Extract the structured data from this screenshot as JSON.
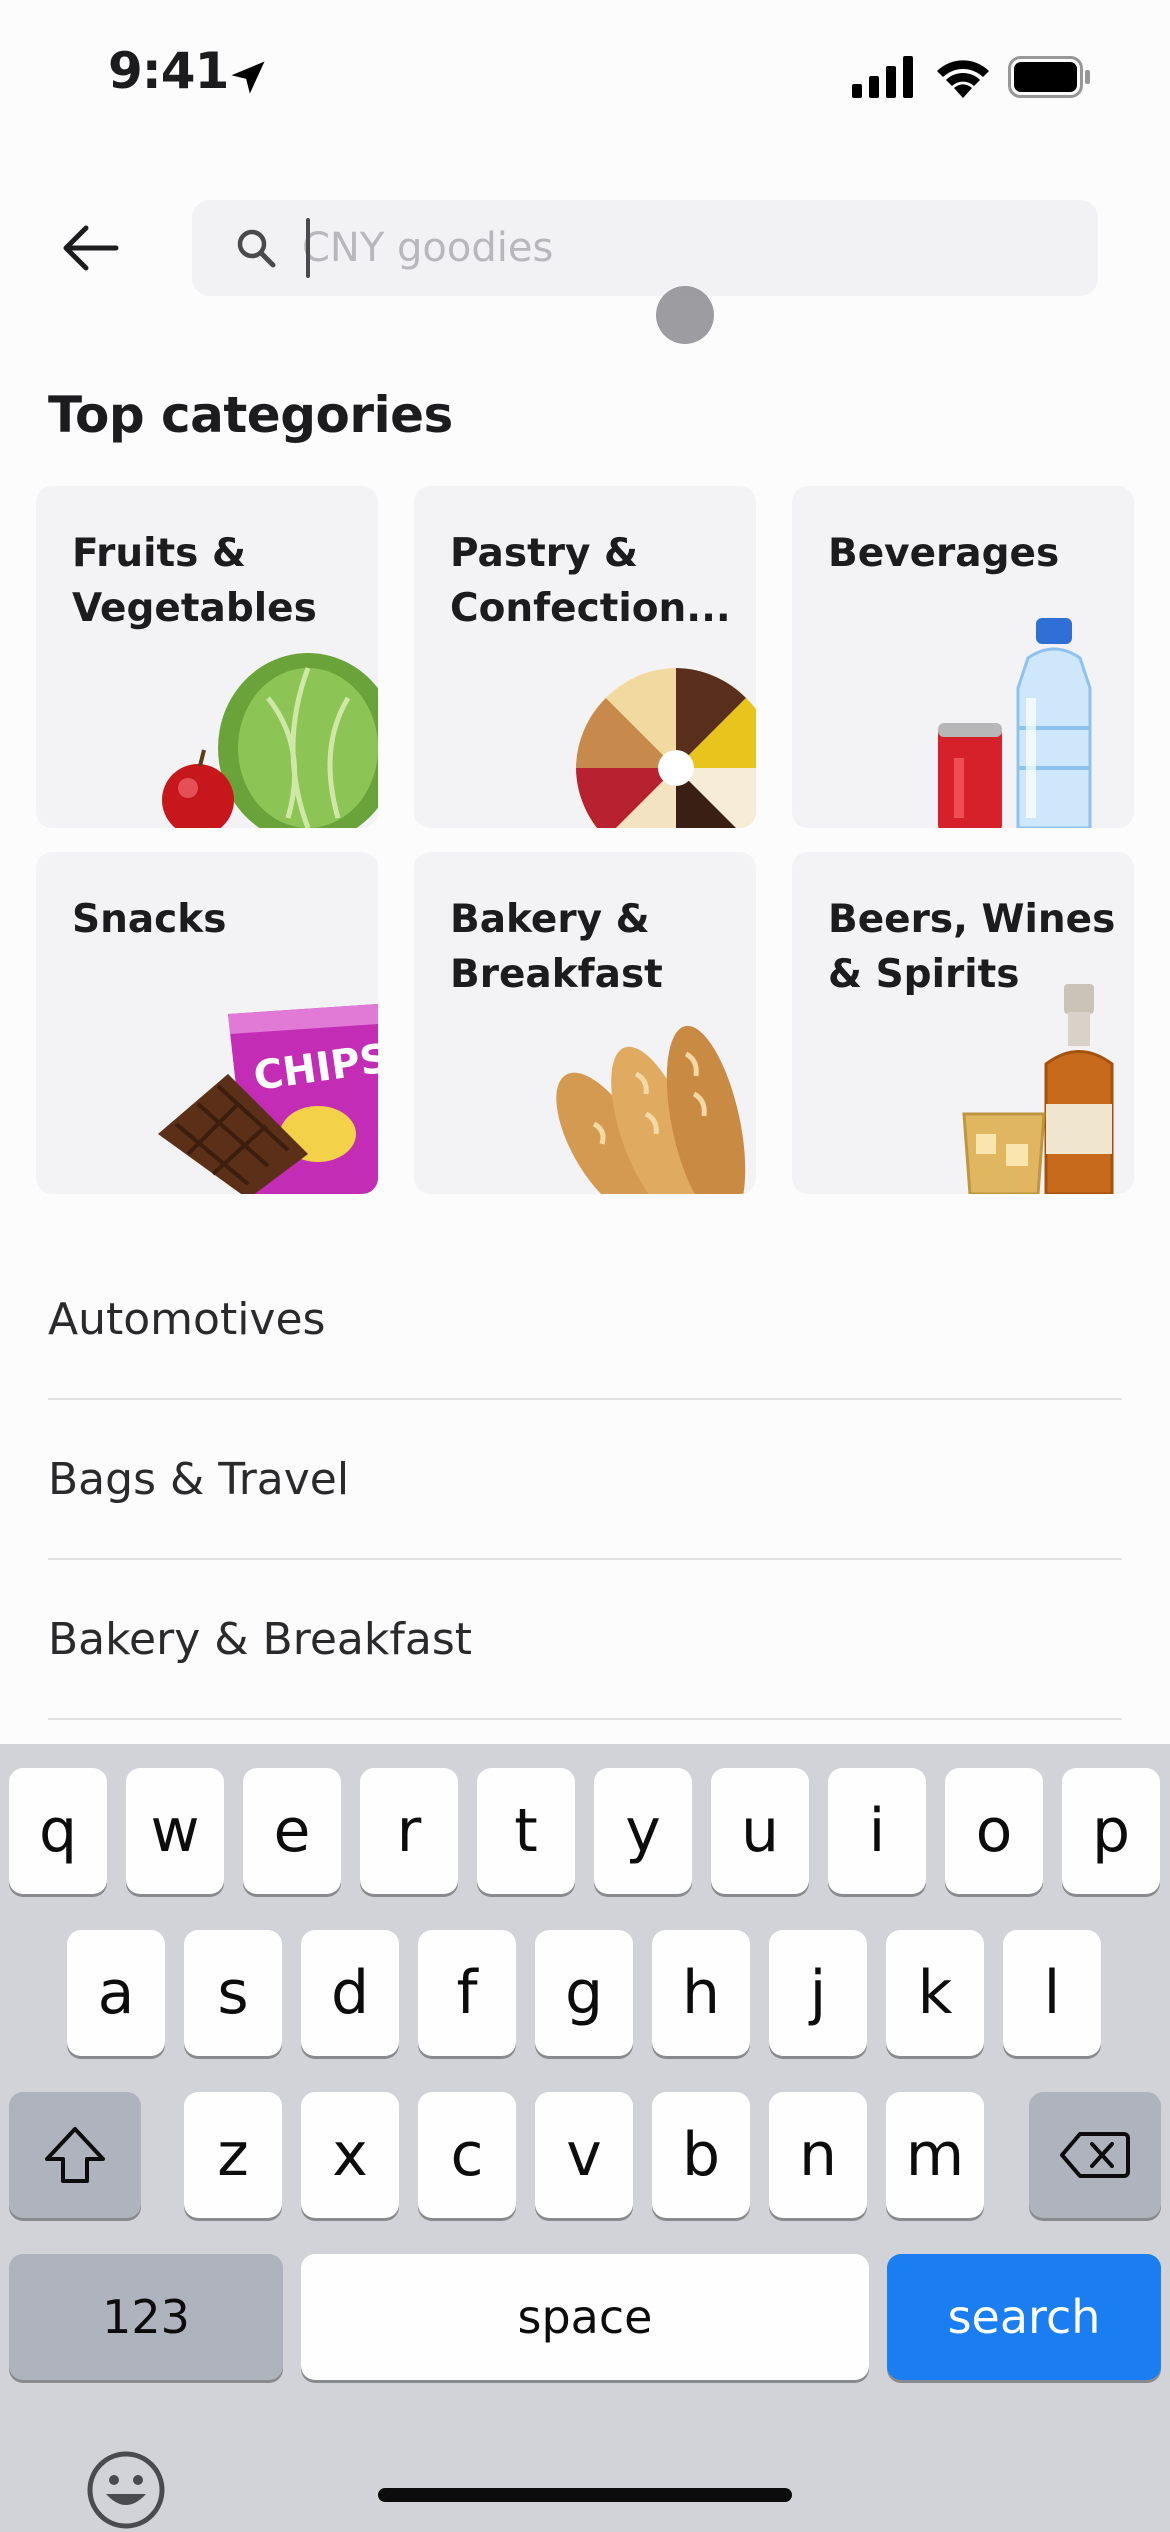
{
  "status_bar": {
    "time": "9:41"
  },
  "search": {
    "placeholder": "CNY goodies",
    "value": ""
  },
  "section_title": "Top categories",
  "top_categories": [
    {
      "label": "Fruits &\nVegetables",
      "art": "cabbage-apple-image"
    },
    {
      "label": "Pastry &\nConfection...",
      "art": "cake-slices-image"
    },
    {
      "label": "Beverages",
      "art": "water-bottle-can-image"
    },
    {
      "label": "Snacks",
      "art": "chips-chocolate-image"
    },
    {
      "label": "Bakery &\nBreakfast",
      "art": "baguettes-image"
    },
    {
      "label": "Beers, Wines\n& Spirits",
      "art": "whisky-bottle-glass-image"
    }
  ],
  "category_list": [
    {
      "label": "Automotives"
    },
    {
      "label": "Bags & Travel"
    },
    {
      "label": "Bakery & Breakfast"
    }
  ],
  "keyboard": {
    "row1": [
      "q",
      "w",
      "e",
      "r",
      "t",
      "y",
      "u",
      "i",
      "o",
      "p"
    ],
    "row2": [
      "a",
      "s",
      "d",
      "f",
      "g",
      "h",
      "j",
      "k",
      "l"
    ],
    "row3": [
      "z",
      "x",
      "c",
      "v",
      "b",
      "n",
      "m"
    ],
    "numbers_label": "123",
    "space_label": "space",
    "search_label": "search"
  },
  "colors": {
    "accent": "#1a7ef2",
    "tile_bg": "#f3f2f5",
    "keyboard_bg": "#d1d3d9"
  }
}
